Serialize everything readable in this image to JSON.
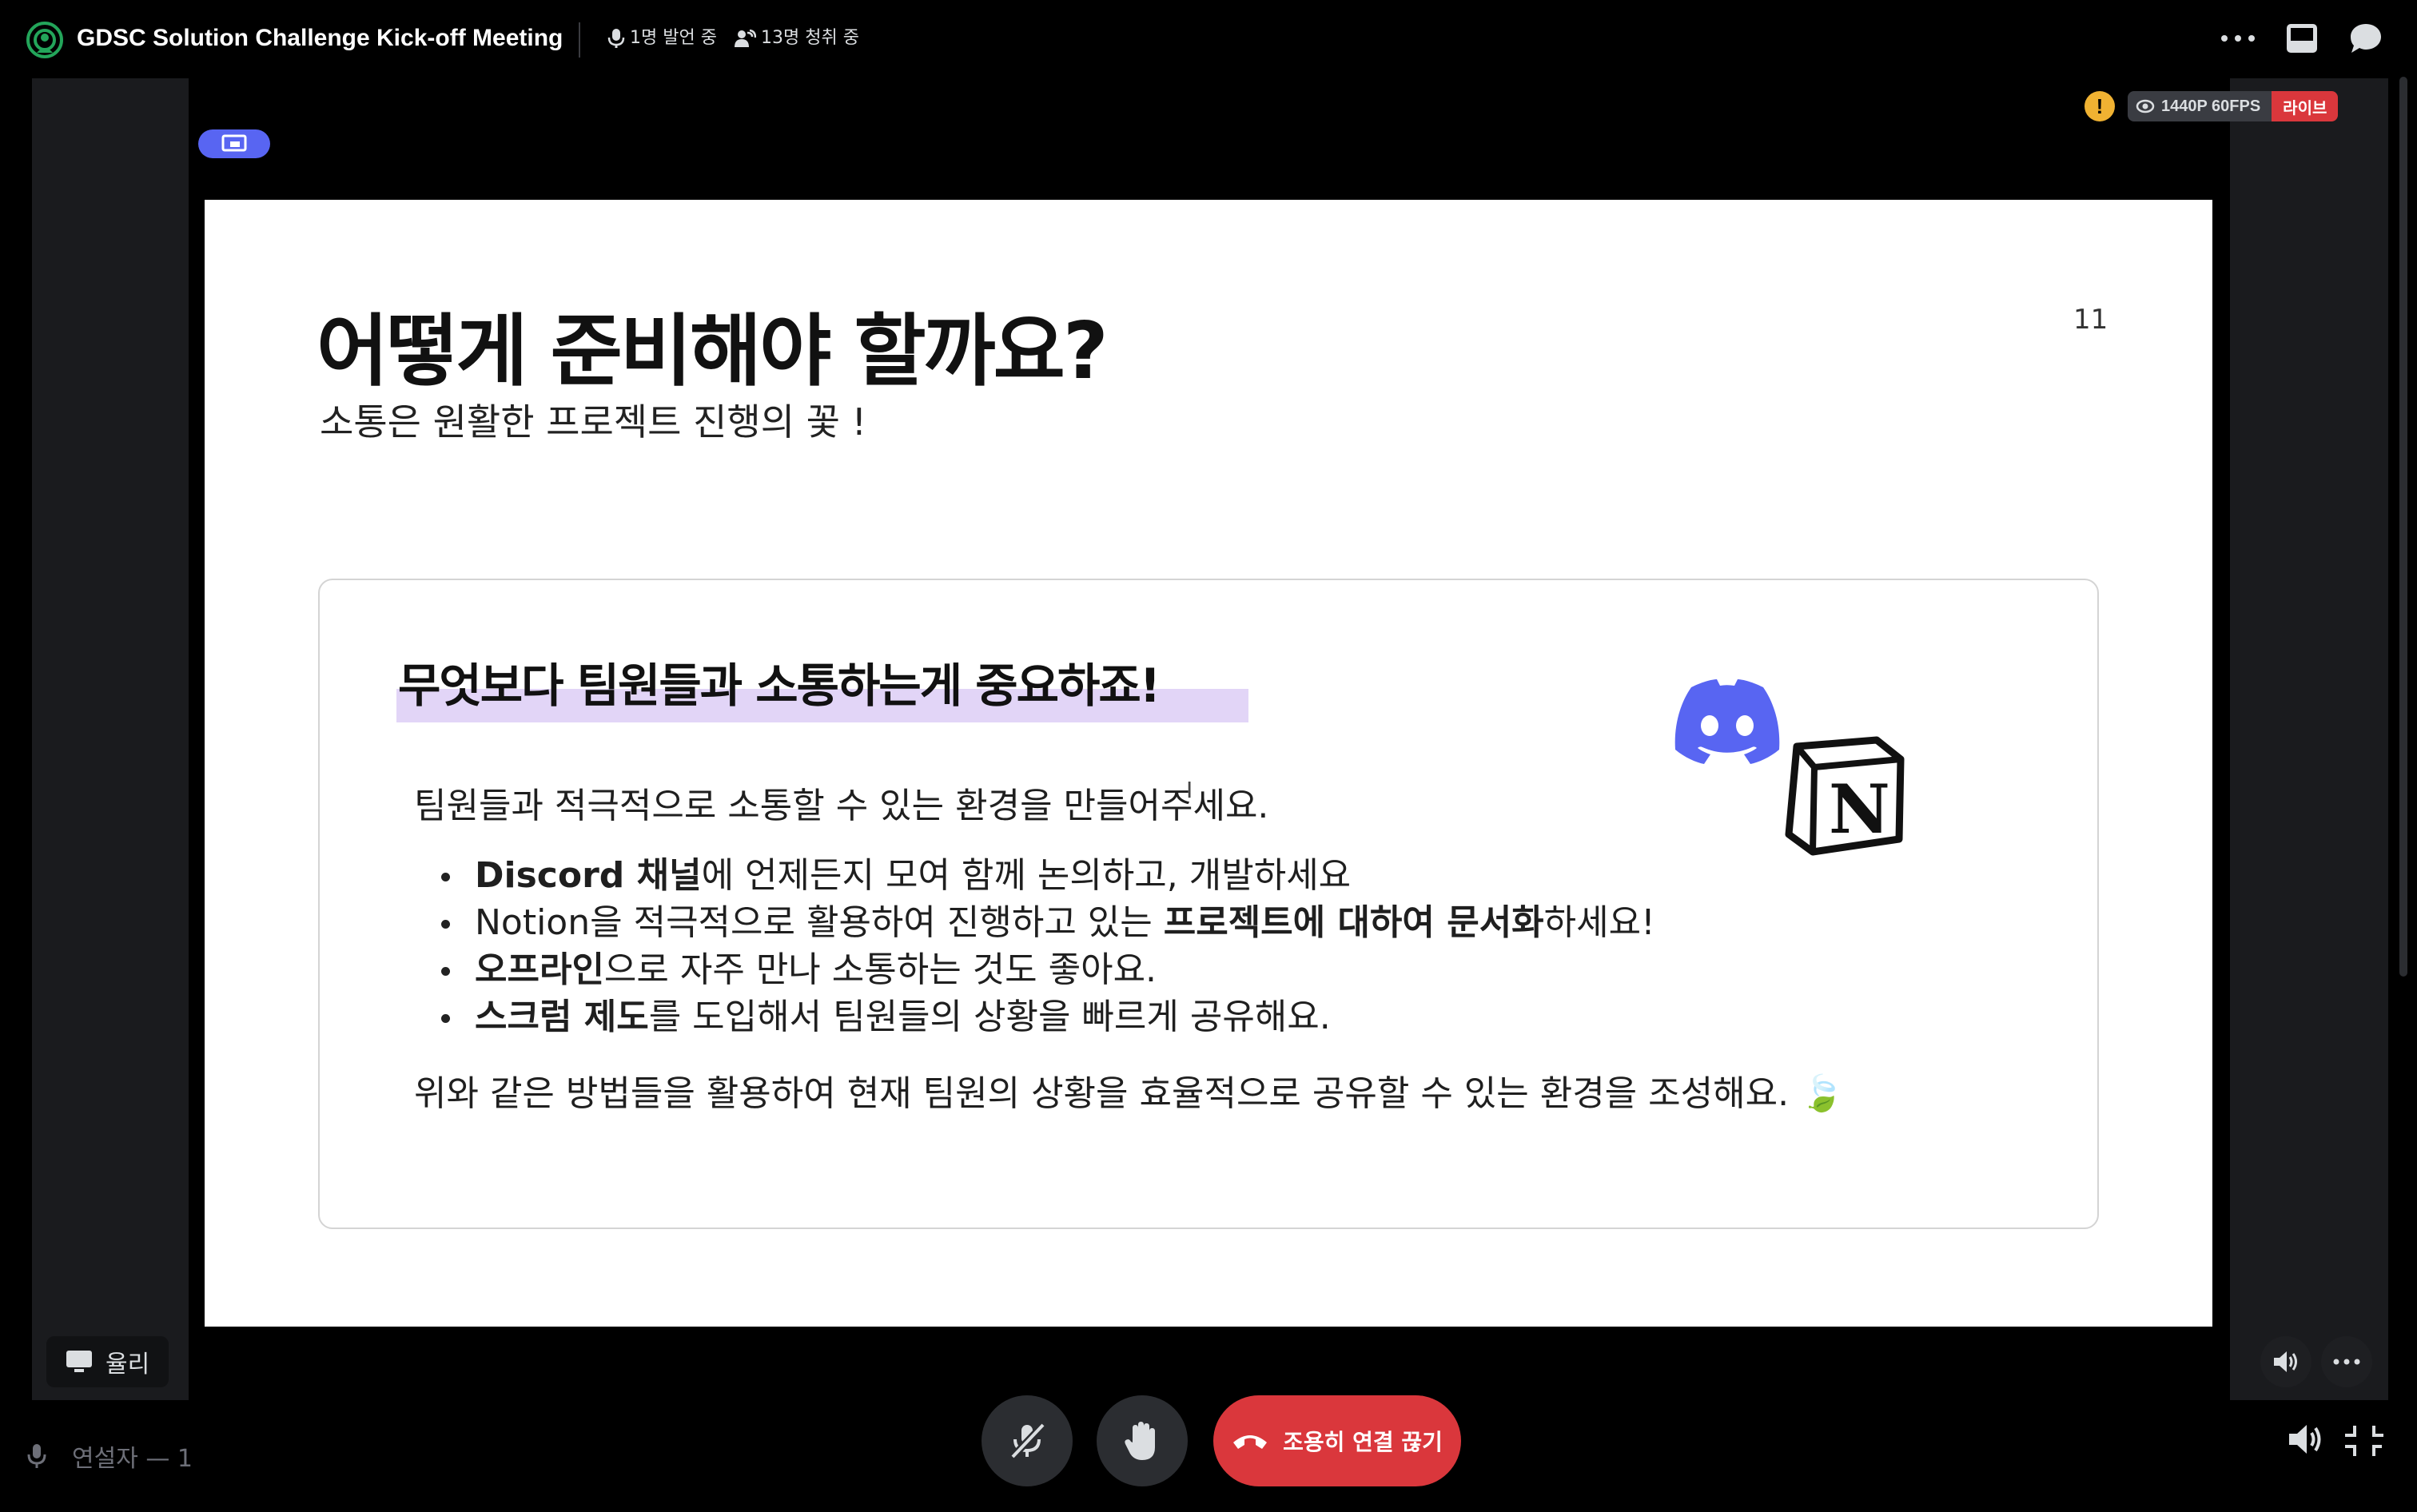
{
  "header": {
    "title": "GDSC Solution Challenge Kick-off Meeting",
    "speaking": "1명 발언 중",
    "listening": "13명 청취 중"
  },
  "stream": {
    "quality": "1440P 60FPS",
    "live_badge": "라이브",
    "warning_symbol": "!"
  },
  "slide": {
    "title": "어떻게 준비해야 할까요?",
    "subtitle": "소통은 원활한 프로젝트 진행의 꽃 !",
    "page_number": "11",
    "card": {
      "heading": "무엇보다 팀원들과 소통하는게 중요하죠!",
      "intro": "팀원들과 적극적으로 소통할 수 있는 환경을 만들어주세요.",
      "bullets": [
        {
          "bold": "Discord 채널",
          "rest": "에 언제든지 모여 함께 논의하고, 개발하세요"
        },
        {
          "pre": "Notion을 적극적으로 활용하여 진행하고 있는 ",
          "bold": "프로젝트에 대하여 문서화",
          "rest": "하세요!"
        },
        {
          "bold": "오프라인",
          "rest": "으로 자주 만나 소통하는 것도 좋아요."
        },
        {
          "bold": "스크럼 제도",
          "rest": "를 도입해서 팀원들의 상황을 빠르게 공유해요."
        }
      ],
      "outro": "위와 같은 방법들을 활용하여 현재 팀원의 상황을 효율적으로 공유할 수 있는 환경을 조성해요. 🍃"
    }
  },
  "footer": {
    "streamer_name": "율리",
    "speakers_label": "연설자 — 1",
    "leave_button": "조용히 연결 끊기"
  },
  "colors": {
    "brand": "#5865f2",
    "danger": "#da373c",
    "warning": "#f0b232",
    "highlight": "#e2d5f7"
  },
  "icons": [
    "stage-icon",
    "microphone-icon",
    "listeners-icon",
    "more-icon",
    "inbox-icon",
    "chat-icon",
    "screen-share-icon",
    "eye-icon",
    "discord-logo-icon",
    "notion-logo-icon",
    "monitor-icon",
    "mic-muted-icon",
    "raise-hand-icon",
    "phone-hangup-icon",
    "volume-icon",
    "collapse-icon"
  ]
}
